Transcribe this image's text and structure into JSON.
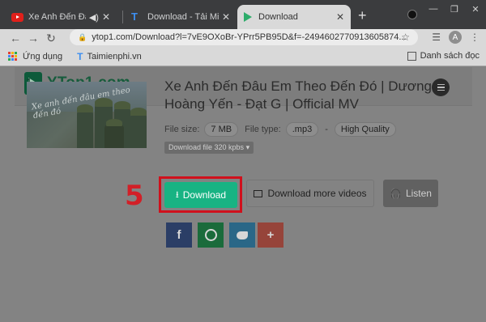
{
  "browser": {
    "tabs": [
      {
        "title": "Xe Anh Đến Đâu E",
        "favicon": "youtube-icon",
        "audio": true
      },
      {
        "title": "Download - Tải Miễn P",
        "favicon": "taimienphi-icon"
      },
      {
        "title": "Download",
        "favicon": "ytop1-play-icon",
        "active": true
      }
    ],
    "url": "ytop1.com/Download?l=7vE9OXoBr-YPrr5PB95D&f=-2494602770913605874...",
    "profile_initial": "A",
    "bookmarks": [
      {
        "label": "Ứng dụng",
        "icon": "apps-grid-icon"
      },
      {
        "label": "Taimienphi.vn",
        "icon": "taimienphi-icon"
      }
    ],
    "reading_list_label": "Danh sách đọc"
  },
  "site": {
    "logo_text": "YTop1.com",
    "video_title": "Xe Anh Đến Đâu Em Theo Đến Đó | Dương Hoàng Yến - Đạt G | Official MV",
    "thumbnail_caption": "Xe anh đến đâu em theo đến đó",
    "file_size_label": "File size:",
    "file_size": "7 MB",
    "file_type_label": "File type:",
    "file_type": ".mp3",
    "quality": "High Quality",
    "quality_select": "Download file 320 kpbs",
    "download_label": "Download",
    "more_label": "Download more videos",
    "listen_label": "Listen",
    "step_number": "5"
  },
  "colors": {
    "download_button": "#18b383",
    "step_highlight": "#d0101c",
    "logo_green": "#175c3d"
  }
}
